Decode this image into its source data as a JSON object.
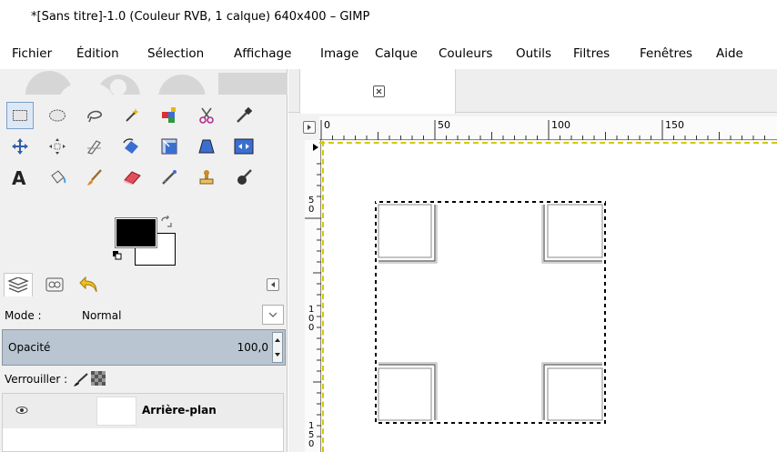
{
  "window": {
    "title": "*[Sans titre]-1.0 (Couleur RVB, 1 calque) 640x400 – GIMP"
  },
  "menubar": {
    "items": [
      {
        "label": "Fichier",
        "name": "menu-fichier"
      },
      {
        "label": "Édition",
        "name": "menu-edition"
      },
      {
        "label": "Sélection",
        "name": "menu-selection"
      },
      {
        "label": "Affichage",
        "name": "menu-affichage"
      },
      {
        "label": "Image",
        "name": "menu-image"
      },
      {
        "label": "Calque",
        "name": "menu-calque"
      },
      {
        "label": "Couleurs",
        "name": "menu-couleurs"
      },
      {
        "label": "Outils",
        "name": "menu-outils"
      },
      {
        "label": "Filtres",
        "name": "menu-filtres"
      },
      {
        "label": "Fenêtres",
        "name": "menu-fenetres"
      },
      {
        "label": "Aide",
        "name": "menu-aide"
      }
    ]
  },
  "toolbox": {
    "tools": [
      "rect-select-icon",
      "ellipse-select-icon",
      "free-select-icon",
      "fuzzy-select-icon",
      "color-select-icon",
      "scissors-icon",
      "color-picker-icon",
      "move-icon",
      "align-icon",
      "crop-icon",
      "rotate-icon",
      "scale-icon",
      "perspective-icon",
      "flip-icon",
      "text-icon",
      "bucket-fill-icon",
      "paintbrush-icon",
      "eraser-icon",
      "airbrush-icon",
      "clone-icon",
      "smudge-icon"
    ],
    "fg_color": "#000000",
    "bg_color": "#ffffff"
  },
  "layers_dock": {
    "mode_label": "Mode :",
    "mode_value": "Normal",
    "opacity_label": "Opacité",
    "opacity_value": "100,0",
    "lock_label": "Verrouiller :",
    "layers": [
      {
        "name": "Arrière-plan",
        "visible": true
      }
    ]
  },
  "image_window": {
    "hruler_labels": [
      "0",
      "50",
      "100",
      "150"
    ],
    "vruler_labels": [
      [
        "5",
        "0"
      ],
      [
        "1",
        "0",
        "0"
      ],
      [
        "1",
        "5",
        "0"
      ]
    ]
  },
  "colors": {
    "guide": "#d6c800",
    "opacity_bg": "#b9c6d1"
  }
}
